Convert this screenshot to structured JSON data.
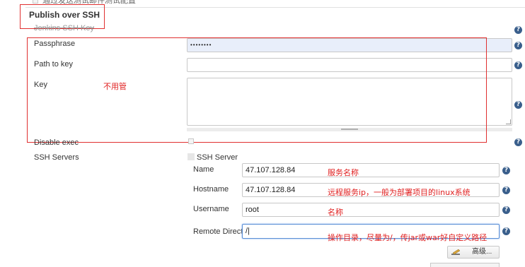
{
  "top_cut_text": "通过发送测试邮件测试配置",
  "section": {
    "title": "Publish over SSH"
  },
  "jenkins_key_label": "Jenkins SSH Key",
  "passphrase": {
    "label": "Passphrase",
    "value": "••••••••"
  },
  "path_to_key": {
    "label": "Path to key",
    "value": ""
  },
  "key": {
    "label": "Key",
    "value": ""
  },
  "disable_exec": {
    "label": "Disable exec"
  },
  "ssh_servers": {
    "label": "SSH Servers",
    "server_header": "SSH Server",
    "name": {
      "label": "Name",
      "value": "47.107.128.84"
    },
    "hostname": {
      "label": "Hostname",
      "value": "47.107.128.84"
    },
    "username": {
      "label": "Username",
      "value": "root"
    },
    "remote_directory": {
      "label": "Remote Directory",
      "value": "/|"
    },
    "advanced_button": "高级..."
  },
  "annotations": {
    "key_note": "不用管",
    "name_note": "服务名称",
    "hostname_note": "远程服务ip，一般为部署项目的linux系统",
    "username_note": "名称",
    "remote_dir_note": "操作目录，尽量为/，传jar或war好自定义路径"
  },
  "help_glyph": "?",
  "colors": {
    "annotation_red": "#e03030",
    "help_blue": "#3a5f8c",
    "passphrase_bg": "#e8eefa"
  }
}
